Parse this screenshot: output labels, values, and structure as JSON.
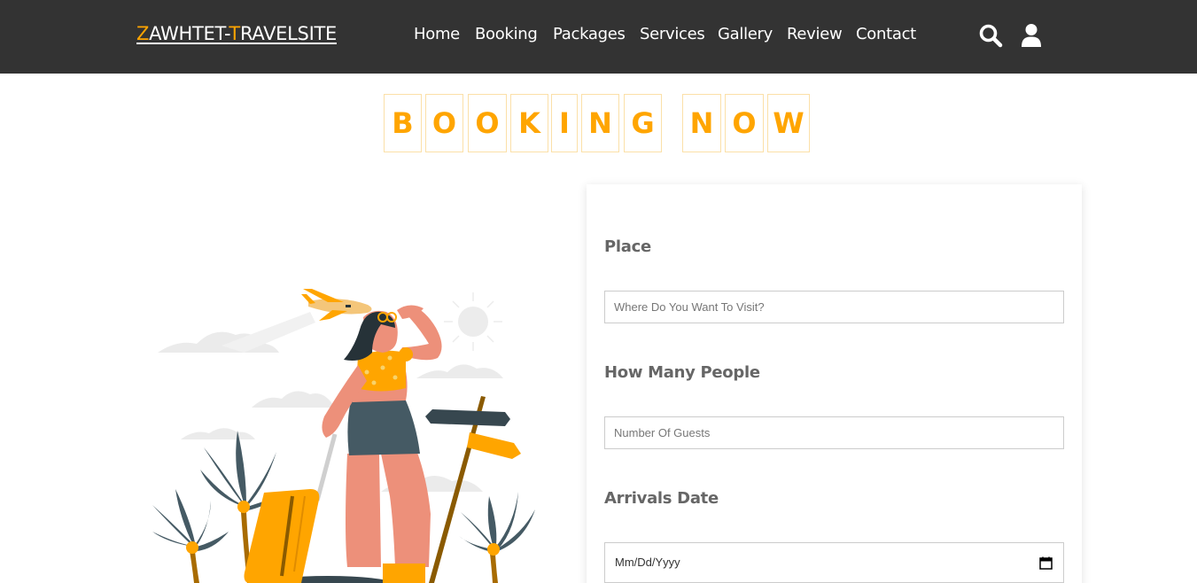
{
  "header": {
    "logo": {
      "first_accent": "Z",
      "part1": "AWHTET-",
      "second_accent": "T",
      "part2": "RAVELSITE"
    },
    "nav": [
      "Home",
      "Booking",
      "Packages",
      "Services",
      "Gallery",
      "Review",
      "Contact"
    ],
    "icons": [
      "search-icon",
      "user-icon"
    ]
  },
  "heading": {
    "letters": [
      "B",
      "O",
      "O",
      "K",
      "I",
      "N",
      "G",
      "N",
      "O",
      "W"
    ]
  },
  "form": {
    "place_label": "Place",
    "place_placeholder": "Where Do You Want To Visit?",
    "people_label": "How Many People",
    "people_placeholder": "Number Of Guests",
    "arrival_label": "Arrivals Date",
    "arrival_value": "Mm/Dd/Yyyy"
  },
  "colors": {
    "header_bg": "#333333",
    "accent": "#ffa500",
    "label": "#666666"
  }
}
